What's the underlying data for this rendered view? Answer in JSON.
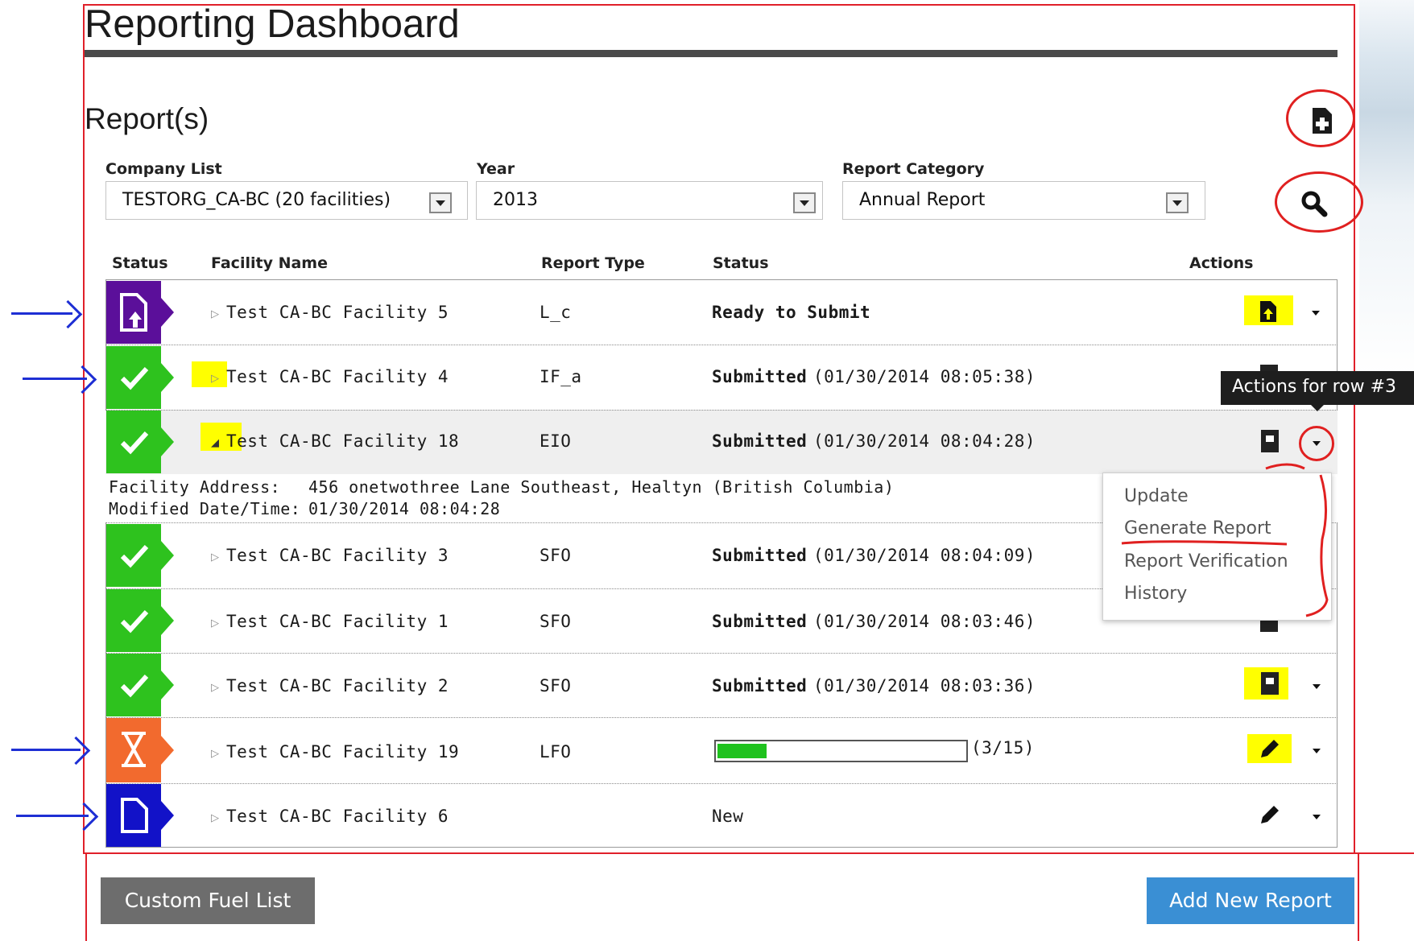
{
  "header": {
    "title": "Reporting Dashboard",
    "subtitle": "Report(s)"
  },
  "filters": {
    "company": {
      "label": "Company List",
      "value": "TESTORG_CA-BC (20 facilities)"
    },
    "year": {
      "label": "Year",
      "value": "2013"
    },
    "category": {
      "label": "Report Category",
      "value": "Annual Report"
    }
  },
  "columns": [
    "Status",
    "Facility Name",
    "Report Type",
    "Status",
    "Actions"
  ],
  "rows": [
    {
      "facility": "Test CA-BC Facility 5",
      "type": "L_c",
      "status_label": "Ready to Submit",
      "status_time": "",
      "badge": "upload-icon",
      "badge_color": "#5b0f9a"
    },
    {
      "facility": "Test CA-BC Facility 4",
      "type": "IF_a",
      "status_label": "Submitted",
      "status_time": "(01/30/2014 08:05:38)",
      "badge": "check-icon",
      "badge_color": "#2ec21e"
    },
    {
      "facility": "Test CA-BC Facility 18",
      "type": "EIO",
      "status_label": "Submitted",
      "status_time": "(01/30/2014 08:04:28)",
      "badge": "check-icon",
      "badge_color": "#2ec21e"
    },
    {
      "facility": "Test CA-BC Facility 3",
      "type": "SFO",
      "status_label": "Submitted",
      "status_time": "(01/30/2014 08:04:09)",
      "badge": "check-icon",
      "badge_color": "#2ec21e"
    },
    {
      "facility": "Test CA-BC Facility 1",
      "type": "SFO",
      "status_label": "Submitted",
      "status_time": "(01/30/2014 08:03:46)",
      "badge": "check-icon",
      "badge_color": "#2ec21e"
    },
    {
      "facility": "Test CA-BC Facility 2",
      "type": "SFO",
      "status_label": "Submitted",
      "status_time": "(01/30/2014 08:03:36)",
      "badge": "check-icon",
      "badge_color": "#2ec21e"
    },
    {
      "facility": "Test CA-BC Facility 19",
      "type": "LFO",
      "status_label": "(3/15)",
      "progress": 0.2,
      "badge": "hourglass-icon",
      "badge_color": "#f26a2e"
    },
    {
      "facility": "Test CA-BC Facility 6",
      "type": "",
      "status_label": "New",
      "status_time": "",
      "badge": "document-icon",
      "badge_color": "#1212c8"
    }
  ],
  "details": {
    "address_label": "Facility Address:",
    "address_value": "456 onetwothree Lane Southeast, Healtyn (British Columbia)",
    "modified_label": "Modified Date/Time:",
    "modified_value": "01/30/2014 08:04:28"
  },
  "tooltip": "Actions for row #3",
  "menu": [
    "Update",
    "Generate Report",
    "Report Verification",
    "History"
  ],
  "footer": {
    "custom_fuel": "Custom Fuel List",
    "add_new": "Add New Report"
  }
}
